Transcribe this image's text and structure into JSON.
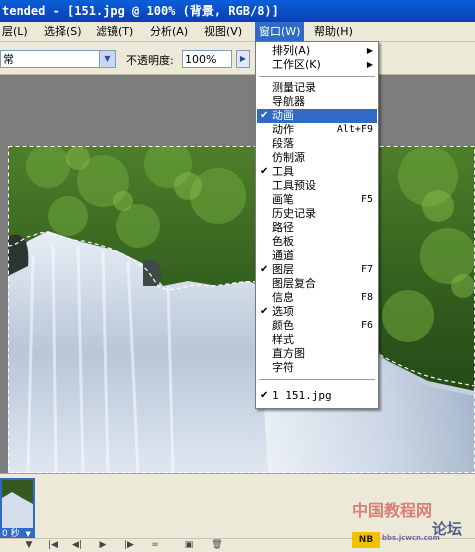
{
  "window": {
    "title": "tended - [151.jpg @ 100% (背景, RGB/8)]"
  },
  "menubar": {
    "items": [
      {
        "label": "层(L)"
      },
      {
        "label": "选择(S)"
      },
      {
        "label": "滤镜(T)"
      },
      {
        "label": "分析(A)"
      },
      {
        "label": "视图(V)"
      },
      {
        "label": "窗口(W)"
      },
      {
        "label": "帮助(H)"
      }
    ]
  },
  "options": {
    "mode_value": "常",
    "opacity_label": "不透明度:",
    "opacity_value": "100%"
  },
  "window_menu": {
    "items": [
      {
        "label": "排列(A)",
        "submenu": true
      },
      {
        "label": "工作区(K)",
        "submenu": true
      },
      {
        "label": "测量记录"
      },
      {
        "label": "导航器"
      },
      {
        "label": "动画",
        "checked": true,
        "highlighted": true
      },
      {
        "label": "动作",
        "shortcut": "Alt+F9"
      },
      {
        "label": "段落"
      },
      {
        "label": "仿制源"
      },
      {
        "label": "工具",
        "checked": true
      },
      {
        "label": "工具预设"
      },
      {
        "label": "画笔",
        "shortcut": "F5"
      },
      {
        "label": "历史记录"
      },
      {
        "label": "路径"
      },
      {
        "label": "色板"
      },
      {
        "label": "通道"
      },
      {
        "label": "图层",
        "checked": true,
        "shortcut": "F7"
      },
      {
        "label": "图层复合"
      },
      {
        "label": "信息",
        "shortcut": "F8"
      },
      {
        "label": "选项",
        "checked": true
      },
      {
        "label": "颜色",
        "shortcut": "F6"
      },
      {
        "label": "样式"
      },
      {
        "label": "直方图"
      },
      {
        "label": "字符"
      },
      {
        "label": "1 151.jpg",
        "checked": true
      }
    ]
  },
  "animation": {
    "frame_time": "0 秒"
  },
  "watermark": {
    "text": "中国教程网",
    "sub": "bbs.jcwcn.com",
    "brand": "论坛"
  },
  "colors": {
    "highlight": "#316ac5",
    "titlebar": "#0a4fc8",
    "menu_bg": "#ece9d8"
  }
}
